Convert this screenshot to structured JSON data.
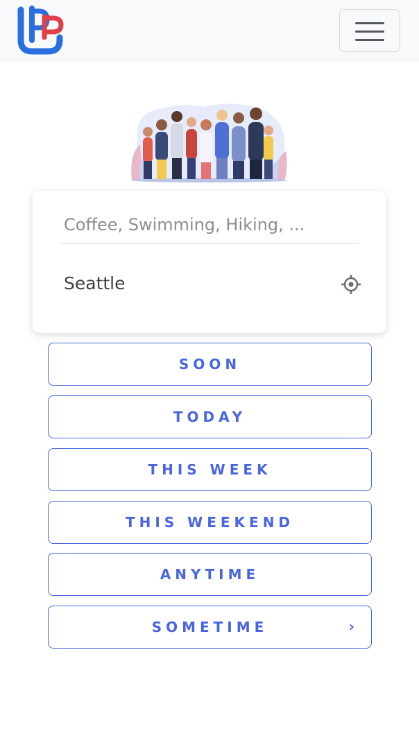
{
  "header": {
    "logo_icon": "pu-monogram-logo",
    "menu_icon": "hamburger-icon"
  },
  "hero": {
    "image": "group-of-people-illustration"
  },
  "search": {
    "activity_placeholder": "Coffee, Swimming, Hiking, ...",
    "location_value": "Seattle",
    "locate_icon": "crosshair-icon"
  },
  "when_options": [
    {
      "label": "SOON"
    },
    {
      "label": "TODAY"
    },
    {
      "label": "THIS WEEK"
    },
    {
      "label": "THIS WEEKEND"
    },
    {
      "label": "ANYTIME"
    },
    {
      "label": "SOMETIME",
      "chevron": "›"
    }
  ],
  "colors": {
    "accent": "#4966e0",
    "logo_blue": "#2a6fe0",
    "logo_red": "#e0404a",
    "navbar_bg": "#f8f9fa"
  }
}
